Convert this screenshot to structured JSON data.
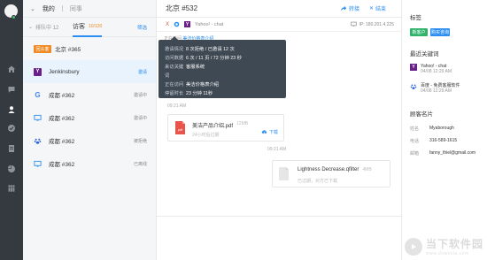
{
  "colors": {
    "accent": "#2b8ef0",
    "rail": "#353a40",
    "orange": "#f08a24",
    "online": "#3cc26c",
    "tag_green": "#2fb36b",
    "tag_blue": "#2b8ef0"
  },
  "top_tabs": {
    "mine": "我的",
    "colleague": "同事"
  },
  "sub_tabs": {
    "queue": "排队中 12",
    "visitors": "访客",
    "visitor_count": "10/120",
    "filter": "筛选"
  },
  "conversations": [
    {
      "badge": "回头客",
      "name": "北京 #365",
      "status": ""
    },
    {
      "icon": "yahoo-icon",
      "name": "Jenkinsbury",
      "status": "邀请"
    },
    {
      "icon": "google-icon",
      "name": "成都 #362",
      "status": "邀请中"
    },
    {
      "icon": "monitor-icon",
      "name": "成都 #362",
      "status": "邀请中"
    },
    {
      "icon": "paw-icon",
      "name": "成都 #362",
      "status": "被拒绝"
    },
    {
      "icon": "monitor-icon",
      "name": "成都 #362",
      "status": "已离线"
    }
  ],
  "chat": {
    "title": "北京 #532",
    "forward": "转接",
    "end": "结束",
    "source": "Yahoo! - chat",
    "ip": "IP: 180.201.4.225",
    "visiting_prefix": "正在访问",
    "visiting_page": "美洁价格表介绍"
  },
  "tooltip": [
    {
      "k": "邀请情况",
      "v": "8 次拒绝 / 已邀请 12 次"
    },
    {
      "k": "访问数据",
      "v": "6 次 / 11 页 / 72 分钟 23 秒"
    },
    {
      "k": "来访关键词",
      "v": "客服系统"
    },
    {
      "k": "正在访问",
      "v": "美洁价格表介绍"
    },
    {
      "k": "停留时长",
      "v": "23 分钟 11秒"
    }
  ],
  "messages": {
    "time1": "09:21 AM",
    "file1": {
      "name": "美洁产品介绍.pdf",
      "size": "12MB",
      "state": "24小时后过期",
      "download": "下载"
    },
    "time2": "09:21 AM",
    "file2": {
      "name": "Lightness Decrease.qfilter",
      "size": "4MB",
      "state": "已过期，对方已下载"
    }
  },
  "right": {
    "tags_title": "标签",
    "tags": [
      "新客户",
      "购买咨询"
    ],
    "keywords_title": "最近关键词",
    "keywords": [
      {
        "icon": "yahoo-icon",
        "text": "Yahoo! - chat",
        "date": "04/08 12:29 AM"
      },
      {
        "icon": "paw-icon",
        "text": "百度 - 免费客服软件",
        "date": "04/08 12:29 AM"
      }
    ],
    "card_title": "顾客名片",
    "card": [
      {
        "k": "姓名",
        "v": "Myaborough"
      },
      {
        "k": "电话",
        "v": "316-589-1615"
      },
      {
        "k": "邮箱",
        "v": "fanny_thiel@gmail.com"
      }
    ]
  },
  "watermark": {
    "cn": "当下软件园",
    "en": "www.downxia.com"
  }
}
